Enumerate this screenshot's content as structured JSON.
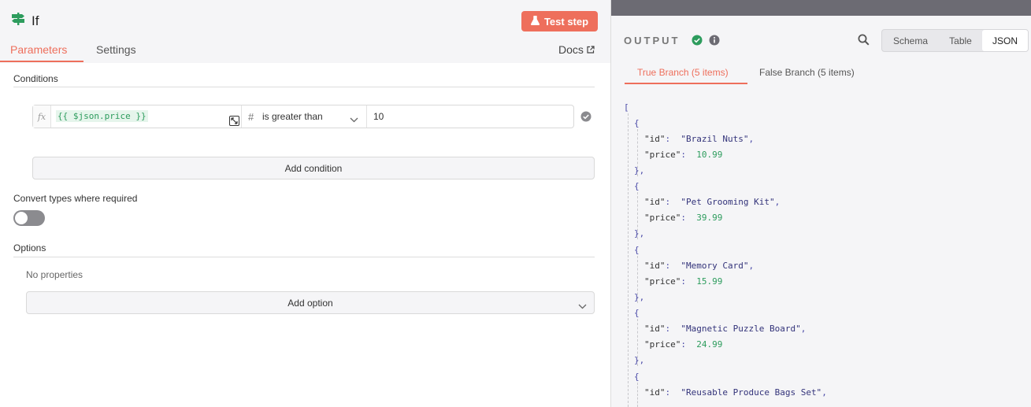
{
  "node": {
    "title": "If"
  },
  "header": {
    "test_step_label": "Test step"
  },
  "tabs": [
    {
      "label": "Parameters"
    },
    {
      "label": "Settings"
    }
  ],
  "docs_label": "Docs",
  "conditions": {
    "label": "Conditions",
    "fx_label": "fx",
    "left_value": "{{ $json.price }}",
    "type_icon": "#",
    "operator": "is greater than",
    "right_value": "10",
    "add_label": "Add condition"
  },
  "convert_types": {
    "label": "Convert types where required",
    "enabled": false
  },
  "options": {
    "label": "Options",
    "empty_text": "No properties",
    "add_label": "Add option"
  },
  "output": {
    "title": "OUTPUT",
    "view_modes": [
      {
        "label": "Schema"
      },
      {
        "label": "Table"
      },
      {
        "label": "JSON"
      }
    ],
    "active_view": "JSON",
    "branches": [
      {
        "label": "True Branch (5 items)"
      },
      {
        "label": "False Branch (5 items)"
      }
    ],
    "items": [
      {
        "id": "\"Brazil Nuts\"",
        "price": "10.99"
      },
      {
        "id": "\"Pet Grooming Kit\"",
        "price": "39.99"
      },
      {
        "id": "\"Memory Card\"",
        "price": "15.99"
      },
      {
        "id": "\"Magnetic Puzzle Board\"",
        "price": "24.99"
      },
      {
        "id": "\"Reusable Produce Bags Set\""
      }
    ]
  },
  "colors": {
    "accent": "#ee6f5c",
    "success": "#2d9c5d",
    "node_icon": "#2d9c5d"
  }
}
